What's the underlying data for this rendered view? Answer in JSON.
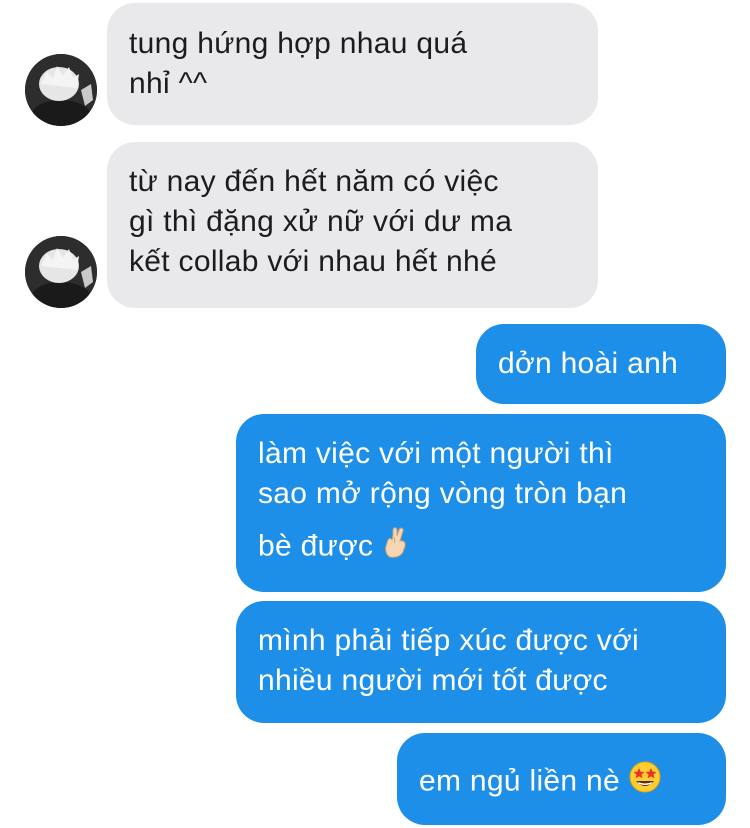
{
  "messages": [
    {
      "direction": "incoming",
      "lines": [
        "tung hứng hợp nhau quá",
        "nhỉ ^^"
      ]
    },
    {
      "direction": "incoming",
      "lines": [
        "từ nay đến hết năm có việc",
        "gì thì đặng xử nữ với dư ma",
        "kết collab với nhau hết nhé"
      ]
    },
    {
      "direction": "outgoing",
      "lines": [
        "dởn hoài anh"
      ]
    },
    {
      "direction": "outgoing",
      "lines": [
        "làm việc với một người thì",
        "sao mở rộng vòng tròn bạn",
        "bè được"
      ],
      "emoji": "crossed-fingers-emoji"
    },
    {
      "direction": "outgoing",
      "lines": [
        "mình phải tiếp xúc được với",
        "nhiều người mới tốt được"
      ]
    },
    {
      "direction": "outgoing",
      "lines": [
        "em ngủ liền nè"
      ],
      "emoji": "star-struck-emoji"
    }
  ],
  "avatar_icon": "user-avatar-icon",
  "colors": {
    "incoming_bubble": "#e9e9eb",
    "outgoing_bubble": "#1e8fe8",
    "background": "#ffffff"
  }
}
